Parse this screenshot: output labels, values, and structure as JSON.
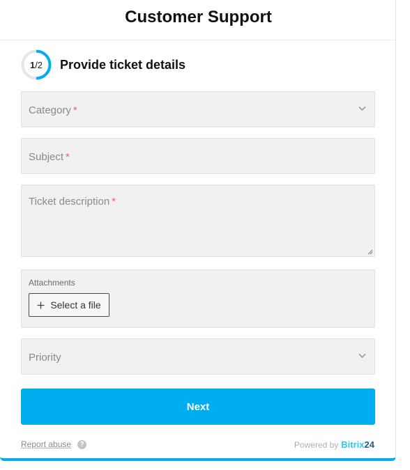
{
  "header": {
    "title": "Customer Support"
  },
  "step": {
    "current": "1",
    "total": "/2",
    "progress": 0.5,
    "title": "Provide ticket details"
  },
  "form": {
    "category": {
      "label": "Category",
      "required": "*"
    },
    "subject": {
      "label": "Subject",
      "required": "*"
    },
    "description": {
      "label": "Ticket description",
      "required": "*"
    },
    "attachments": {
      "label": "Attachments",
      "button_label": "Select a file"
    },
    "priority": {
      "label": "Priority"
    }
  },
  "actions": {
    "next_label": "Next"
  },
  "footer": {
    "report_label": "Report abuse",
    "help_glyph": "?",
    "powered_label": "Powered by",
    "brand_name": "Bitrix",
    "brand_suffix": "24"
  },
  "colors": {
    "accent": "#00aeef",
    "required": "#e26666",
    "field_bg": "#f1f1f1"
  }
}
